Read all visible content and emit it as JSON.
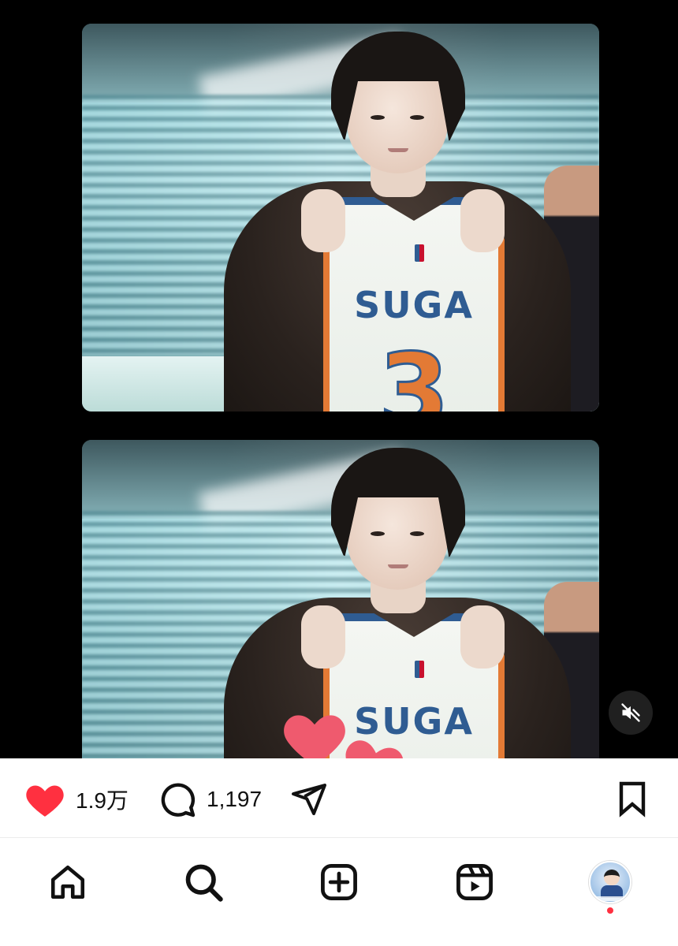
{
  "post": {
    "jersey_name": "SUGA",
    "jersey_number": "3"
  },
  "actions": {
    "like_count": "1.9万",
    "comment_count": "1,197"
  },
  "icons": {
    "like": "heart-filled-icon",
    "comment": "comment-bubble-icon",
    "share": "paper-plane-icon",
    "save": "bookmark-icon",
    "mute": "speaker-muted-icon",
    "home": "home-icon",
    "search": "search-icon",
    "create": "plus-square-icon",
    "reels": "reels-icon",
    "profile": "profile-avatar"
  },
  "colors": {
    "like": "#ff3040",
    "floating_heart": "#ef5a6e",
    "notification_dot": "#ff3040",
    "jersey_text": "#2f5c92",
    "jersey_number": "#e37a35"
  }
}
